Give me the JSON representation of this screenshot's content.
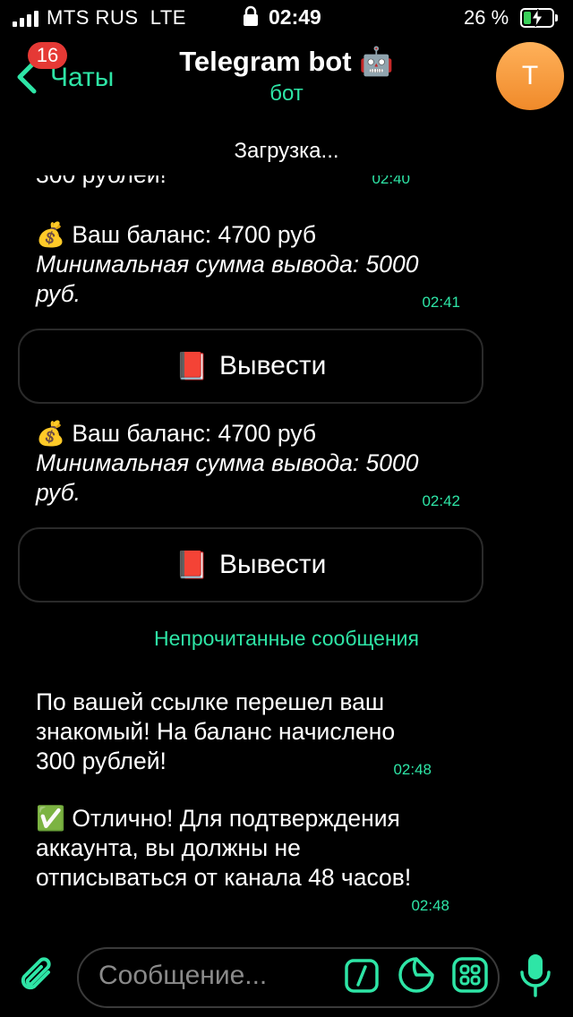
{
  "status": {
    "carrier": "MTS RUS",
    "network": "LTE",
    "time": "02:49",
    "battery_percent": "26 %",
    "battery_level": 0.26
  },
  "header": {
    "back_label": "Чаты",
    "unread_count": "16",
    "title": "Telegram bot",
    "title_emoji": "🤖",
    "subtitle": "бот",
    "avatar_letter": "T",
    "loading": "Загрузка..."
  },
  "messages": [
    {
      "partial_text": "300 рублей!",
      "time": "02:40"
    },
    {
      "emoji": "💰",
      "line1": "Ваш баланс: 4700 руб",
      "line2": "Минимальная сумма вывода: 5000 руб.",
      "time": "02:41",
      "button": {
        "emoji": "📕",
        "label": "Вывести"
      }
    },
    {
      "emoji": "💰",
      "line1": "Ваш баланс: 4700 руб",
      "line2": "Минимальная сумма вывода: 5000 руб.",
      "time": "02:42",
      "button": {
        "emoji": "📕",
        "label": "Вывести"
      }
    },
    {
      "text": "По вашей ссылке перешел ваш знакомый! На баланс начислено 300 рублей!",
      "time": "02:48"
    },
    {
      "emoji": "✅",
      "text": "Отлично! Для подтверждения аккаунта, вы должны не отписываться от канала 48 часов!",
      "time": "02:48"
    }
  ],
  "unread_divider": "Непрочитанные сообщения",
  "composer": {
    "placeholder": "Сообщение..."
  },
  "colors": {
    "accent": "#2ee5a6",
    "badge": "#e53935",
    "avatar": "#f5a040"
  }
}
